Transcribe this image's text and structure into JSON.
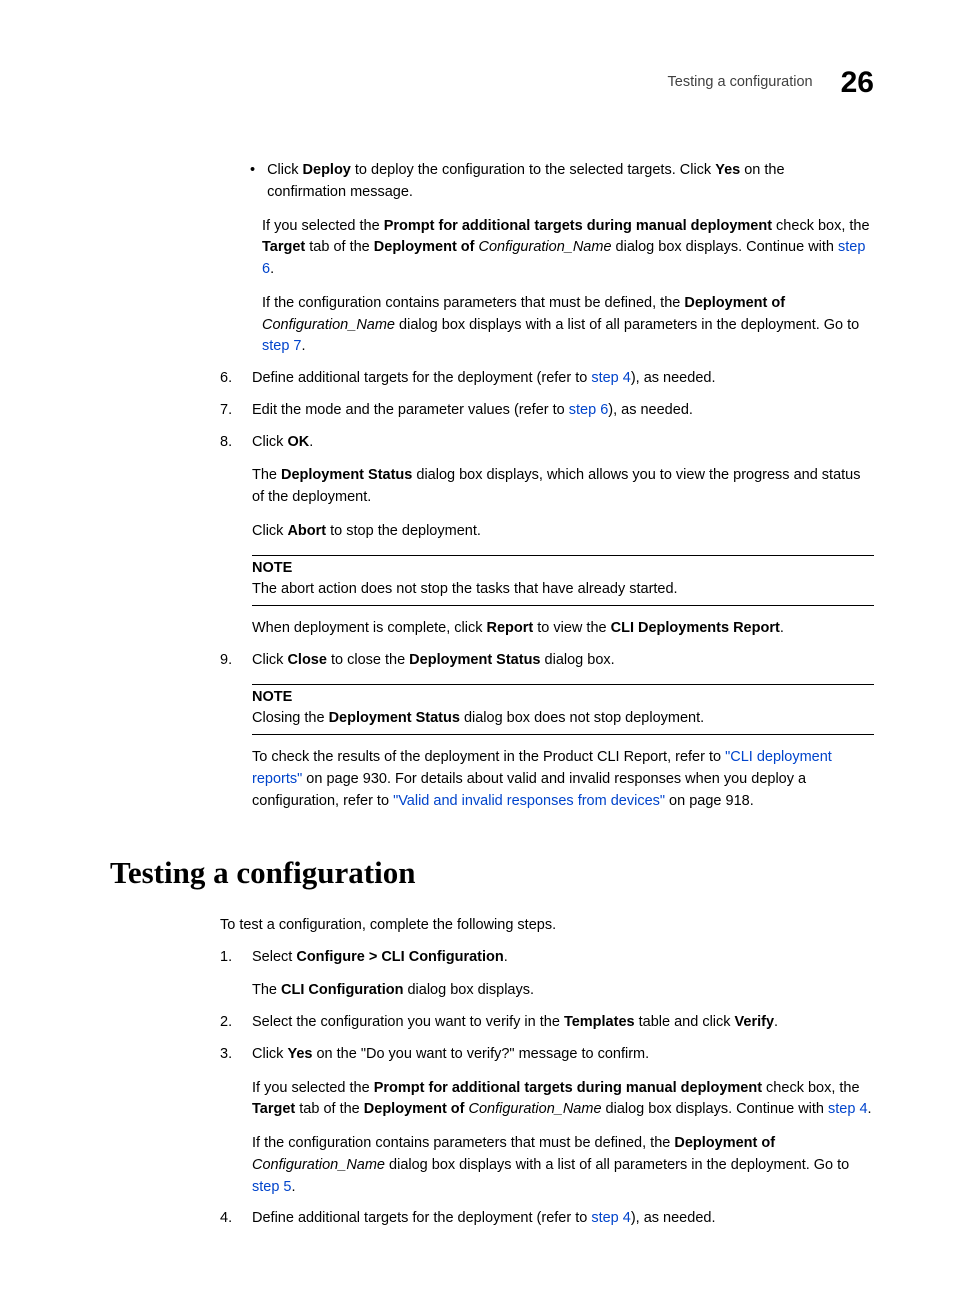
{
  "header": {
    "title": "Testing a configuration",
    "chapter": "26"
  },
  "bullet1": {
    "t1": "Click ",
    "b1": "Deploy",
    "t2": " to deploy the configuration to the selected targets. Click ",
    "b2": "Yes",
    "t3": " on the confirmation message."
  },
  "bullet1_p2": {
    "t1": "If you selected the ",
    "b1": "Prompt for additional targets during manual deployment",
    "t2": " check box, the ",
    "b2": "Target",
    "t3": " tab of the ",
    "b3": "Deployment of",
    "t4": " ",
    "i1": "Configuration_Name",
    "t5": " dialog box displays. Continue with ",
    "link1": "step 6",
    "t6": "."
  },
  "bullet1_p3": {
    "t1": "If the configuration contains parameters that must be defined, the ",
    "b1": "Deployment of",
    "t2": " ",
    "i1": "Configuration_Name",
    "t3": " dialog box displays with a list of all parameters in the deployment. Go to ",
    "link1": "step 7",
    "t4": "."
  },
  "step6": {
    "num": "6.",
    "t1": "Define additional targets for the deployment (refer to ",
    "link1": "step 4",
    "t2": "), as needed."
  },
  "step7": {
    "num": "7.",
    "t1": "Edit the mode and the parameter values (refer to ",
    "link1": "step 6",
    "t2": "), as needed."
  },
  "step8": {
    "num": "8.",
    "t1": "Click ",
    "b1": "OK",
    "t2": "."
  },
  "step8_p1": {
    "t1": "The ",
    "b1": "Deployment Status",
    "t2": " dialog box displays, which allows you to view the progress and status of the deployment."
  },
  "step8_p2": {
    "t1": "Click ",
    "b1": "Abort",
    "t2": " to stop the deployment."
  },
  "note1": {
    "label": "NOTE",
    "text": "The abort action does not stop the tasks that have already started."
  },
  "step8_p3": {
    "t1": "When deployment is complete, click ",
    "b1": "Report",
    "t2": " to view the ",
    "b2": "CLI Deployments Report",
    "t3": "."
  },
  "step9": {
    "num": "9.",
    "t1": "Click ",
    "b1": "Close",
    "t2": " to close the ",
    "b2": "Deployment Status",
    "t3": " dialog box."
  },
  "note2": {
    "label": "NOTE",
    "t1": "Closing the ",
    "b1": "Deployment Status",
    "t2": " dialog box does not stop deployment."
  },
  "step9_p1": {
    "t1": "To check the results of the deployment in the Product CLI Report, refer to ",
    "link1": "\"CLI deployment reports\"",
    "t2": " on page 930. For details about valid and invalid responses when you deploy a configuration, refer to ",
    "link2": "\"Valid and invalid responses from devices\"",
    "t3": " on page 918."
  },
  "heading2": "Testing a configuration",
  "intro": "To test a configuration, complete the following steps.",
  "tstep1": {
    "num": "1.",
    "t1": "Select ",
    "b1": "Configure > CLI Configuration",
    "t2": "."
  },
  "tstep1_p1": {
    "t1": "The ",
    "b1": "CLI Configuration",
    "t2": " dialog box displays."
  },
  "tstep2": {
    "num": "2.",
    "t1": "Select the configuration you want to verify in the ",
    "b1": "Templates",
    "t2": " table and click ",
    "b2": "Verify",
    "t3": "."
  },
  "tstep3": {
    "num": "3.",
    "t1": "Click ",
    "b1": "Yes",
    "t2": " on the \"Do you want to verify?\" message to confirm."
  },
  "tstep3_p1": {
    "t1": "If you selected the ",
    "b1": "Prompt for additional targets during manual deployment",
    "t2": " check box, the ",
    "b2": "Target",
    "t3": " tab of the ",
    "b3": "Deployment of",
    "t4": " ",
    "i1": "Configuration_Name",
    "t5": " dialog box displays. Continue with ",
    "link1": "step 4",
    "t6": "."
  },
  "tstep3_p2": {
    "t1": "If the configuration contains parameters that must be defined, the ",
    "b1": "Deployment of",
    "t2": " ",
    "i1": "Configuration_Name",
    "t3": " dialog box displays with a list of all parameters in the deployment. Go to ",
    "link1": "step 5",
    "t4": "."
  },
  "tstep4": {
    "num": "4.",
    "t1": "Define additional targets for the deployment (refer to ",
    "link1": "step 4",
    "t2": "), as needed."
  }
}
